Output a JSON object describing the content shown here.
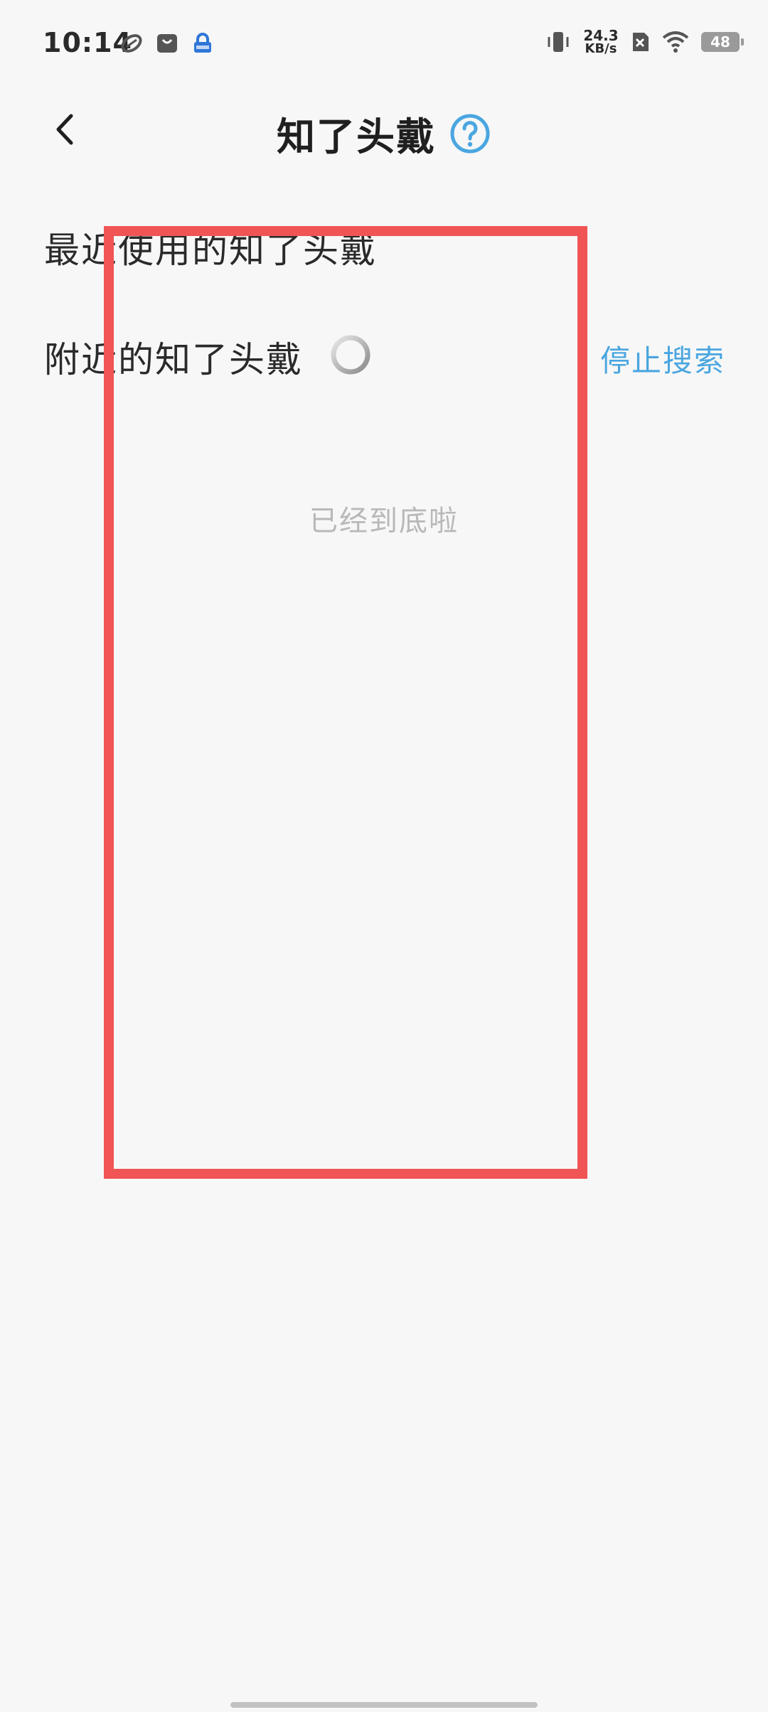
{
  "status_bar": {
    "time": "10:14",
    "net_speed_value": "24.3",
    "net_speed_unit": "KB/s",
    "battery": "48"
  },
  "header": {
    "title": "知了头戴"
  },
  "sections": {
    "recent_title": "最近使用的知了头戴",
    "nearby_title": "附近的知了头戴",
    "stop_search_label": "停止搜索",
    "end_of_list": "已经到底啦"
  },
  "colors": {
    "accent": "#4aa6e0",
    "highlight": "#f05454",
    "background": "#f7f7f7"
  },
  "icons": {
    "back": "back-chevron-icon",
    "help": "question-circle-icon",
    "loading": "loading-spinner-icon"
  }
}
